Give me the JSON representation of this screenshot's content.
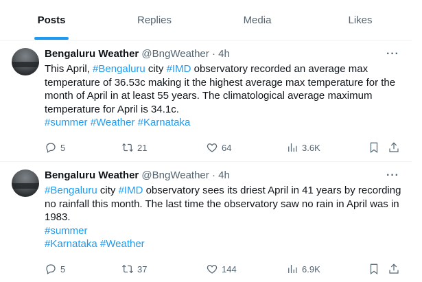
{
  "tabs": [
    {
      "label": "Posts",
      "active": true
    },
    {
      "label": "Replies",
      "active": false
    },
    {
      "label": "Media",
      "active": false
    },
    {
      "label": "Likes",
      "active": false
    }
  ],
  "accent_color": "#1d9bf0",
  "posts": [
    {
      "author_name": "Bengaluru Weather",
      "handle": "@BngWeather",
      "time": "· 4h",
      "more_icon": "more-horizontal-icon",
      "text_segments": [
        {
          "t": "This April, ",
          "tag": false
        },
        {
          "t": "#Bengaluru",
          "tag": true
        },
        {
          "t": " city ",
          "tag": false
        },
        {
          "t": "#IMD",
          "tag": true
        },
        {
          "t": " observatory recorded an average max temperature of 36.53c making it the highest average max temperature for the month of April in at least 55 years. The climatological average maximum temperature for April is 34.1c.",
          "tag": false
        }
      ],
      "hashtag_lines": [
        [
          "#summer",
          "#Weather",
          "#Karnataka"
        ]
      ],
      "replies": "5",
      "reposts": "21",
      "likes": "64",
      "views": "3.6K"
    },
    {
      "author_name": "Bengaluru Weather",
      "handle": "@BngWeather",
      "time": "· 4h",
      "more_icon": "more-horizontal-icon",
      "text_segments": [
        {
          "t": "#Bengaluru",
          "tag": true
        },
        {
          "t": " city ",
          "tag": false
        },
        {
          "t": "#IMD",
          "tag": true
        },
        {
          "t": " observatory sees its driest April in 41 years by recording no rainfall this month. The last time the observatory saw no rain in April was in 1983.",
          "tag": false
        }
      ],
      "hashtag_lines": [
        [
          "#summer"
        ],
        [
          "#Karnataka",
          "#Weather"
        ]
      ],
      "replies": "5",
      "reposts": "37",
      "likes": "144",
      "views": "6.9K"
    }
  ]
}
